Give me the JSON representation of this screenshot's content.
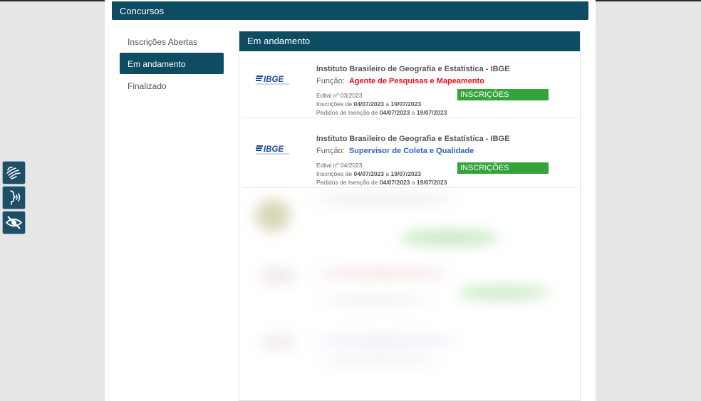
{
  "header": {
    "title": "Concursos"
  },
  "sidebar": {
    "items": [
      {
        "label": "Inscrições Abertas",
        "active": false
      },
      {
        "label": "Em andamento",
        "active": true
      },
      {
        "label": "Finalizado",
        "active": false
      }
    ]
  },
  "panel": {
    "title": "Em andamento",
    "cards": [
      {
        "logo": "IBGE",
        "org": "Instituto Brasileiro de Geografia e Estatística - IBGE",
        "funcao_label": "Função:",
        "funcao": "Agente de Pesquisas e Mapeamento",
        "funcao_color": "#e8121b",
        "edital_label": "Edital nº",
        "edital": "03/2023",
        "inscricoes_label": "Inscrições de",
        "inscricoes_inicio": "04/07/2023",
        "inscricoes_a": "a",
        "inscricoes_fim": "19/07/2023",
        "isencao_label": "Pedidos de Isenção de",
        "isencao_inicio": "04/07/2023",
        "isencao_a": "a",
        "isencao_fim": "19/07/2023",
        "status": "INSCRIÇÕES ABERTAS!"
      },
      {
        "logo": "IBGE",
        "org": "Instituto Brasileiro de Geografia e Estatística - IBGE",
        "funcao_label": "Função:",
        "funcao": "Supervisor de Coleta e Qualidade",
        "funcao_color": "#2e64c4",
        "edital_label": "Edital nº",
        "edital": "04/2023",
        "inscricoes_label": "Inscrições de",
        "inscricoes_inicio": "04/07/2023",
        "inscricoes_a": "a",
        "inscricoes_fim": "19/07/2023",
        "isencao_label": "Pedidos de Isenção de",
        "isencao_inicio": "04/07/2023",
        "isencao_a": "a",
        "isencao_fim": "19/07/2023",
        "status": "INSCRIÇÕES ABERTAS!"
      }
    ]
  },
  "accessibility": {
    "buttons": [
      {
        "icon": "sign-language-icon"
      },
      {
        "icon": "audio-description-icon"
      },
      {
        "icon": "eye-slash-icon"
      }
    ]
  },
  "colors": {
    "primary": "#0d4c62",
    "badge_green": "#33a33a",
    "ibge_blue": "#1f4e9a"
  }
}
